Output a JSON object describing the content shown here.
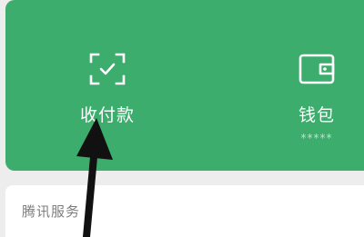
{
  "pay_card": {
    "accent": "#3cad6c",
    "items": [
      {
        "label": "收付款",
        "icon": "scan-check-icon"
      },
      {
        "label": "钱包",
        "sub": "*****",
        "icon": "wallet-icon"
      }
    ]
  },
  "services": {
    "title": "腾讯服务"
  },
  "overlay": {
    "arrow": "annotation-arrow-icon"
  }
}
